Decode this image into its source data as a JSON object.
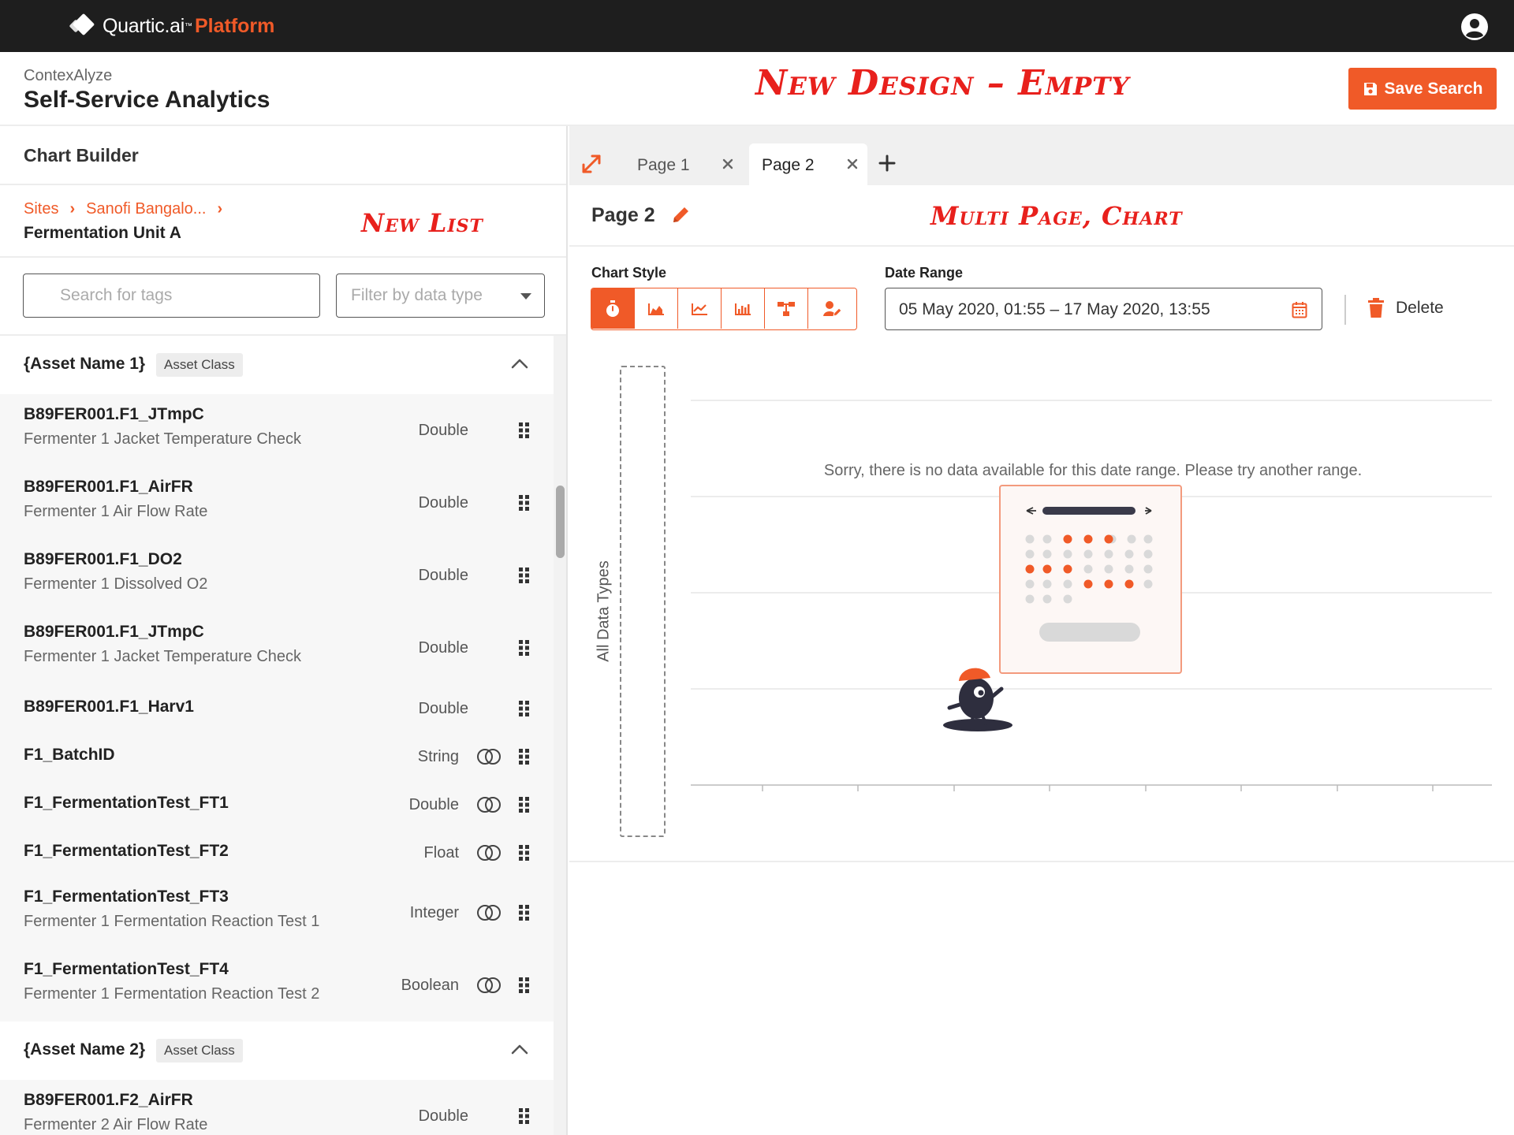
{
  "topbar": {
    "brand": "Quartic.ai",
    "trademark": "™",
    "platform": "Platform",
    "user_icon": "user-circle-icon"
  },
  "header": {
    "app_name": "ContexAlyze",
    "title": "Self-Service Analytics",
    "save_label": "Save Search",
    "annotation": "New Design – Empty"
  },
  "left": {
    "panel_title": "Chart Builder",
    "breadcrumbs": [
      "Sites",
      "Sanofi Bangalo..."
    ],
    "current": "Fermentation Unit A",
    "annotation": "New List",
    "search_placeholder": "Search for tags",
    "filter_placeholder": "Filter by data type",
    "groups": [
      {
        "name": "{Asset Name 1}",
        "chip": "Asset Class",
        "tags": [
          {
            "name": "B89FER001.F1_JTmpC",
            "desc": "Fermenter 1 Jacket Temperature Check",
            "type": "Double",
            "linked": false
          },
          {
            "name": "B89FER001.F1_AirFR",
            "desc": "Fermenter 1 Air Flow Rate",
            "type": "Double",
            "linked": false
          },
          {
            "name": "B89FER001.F1_DO2",
            "desc": "Fermenter 1 Dissolved O2",
            "type": "Double",
            "linked": false
          },
          {
            "name": "B89FER001.F1_JTmpC",
            "desc": "Fermenter 1 Jacket Temperature Check",
            "type": "Double",
            "linked": false
          },
          {
            "name": "B89FER001.F1_Harv1",
            "desc": "",
            "type": "Double",
            "linked": false
          },
          {
            "name": "F1_BatchID",
            "desc": "",
            "type": "String",
            "linked": true
          },
          {
            "name": "F1_FermentationTest_FT1",
            "desc": "",
            "type": "Double",
            "linked": true
          },
          {
            "name": "F1_FermentationTest_FT2",
            "desc": "",
            "type": "Float",
            "linked": true
          },
          {
            "name": "F1_FermentationTest_FT3",
            "desc": "Fermenter 1 Fermentation Reaction Test 1",
            "type": "Integer",
            "linked": true
          },
          {
            "name": "F1_FermentationTest_FT4",
            "desc": "Fermenter 1 Fermentation Reaction Test 2",
            "type": "Boolean",
            "linked": true
          }
        ]
      },
      {
        "name": "{Asset Name 2}",
        "chip": "Asset Class",
        "tags": [
          {
            "name": "B89FER001.F2_AirFR",
            "desc": "Fermenter 2 Air Flow Rate",
            "type": "Double",
            "linked": false
          }
        ]
      }
    ]
  },
  "right": {
    "tabs": [
      {
        "label": "Page 1",
        "active": false
      },
      {
        "label": "Page 2",
        "active": true
      }
    ],
    "page_title": "Page 2",
    "annotation": "Multi Page, Chart",
    "chart_style_label": "Chart Style",
    "chart_styles": [
      "timer-icon",
      "area-chart-icon",
      "line-chart-icon",
      "bar-chart-icon",
      "flow-chart-icon",
      "user-edit-icon"
    ],
    "date_range_label": "Date Range",
    "date_range_value": "05 May 2020, 01:55 – 17 May 2020, 13:55",
    "delete_label": "Delete",
    "y_axis_label": "All Data Types",
    "empty_message": "Sorry, there is no data available for this date range. Please try another range."
  },
  "colors": {
    "accent": "#f05a28",
    "topbar": "#1e1e1e",
    "annotation": "#e8201c"
  }
}
